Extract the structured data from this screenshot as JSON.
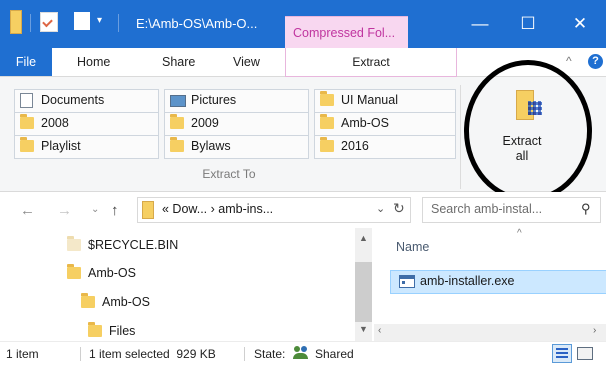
{
  "window": {
    "title": "E:\\Amb-OS\\Amb-O...",
    "context_tab": "Compressed Fol...",
    "controls": {
      "minimize": "—",
      "maximize": "☐",
      "close": "✕"
    }
  },
  "quick_access": [
    "folder-icon",
    "properties-icon",
    "new-folder-icon",
    "customize-dropdown-icon"
  ],
  "ribbon_tabs": [
    {
      "label": "File"
    },
    {
      "label": "Home"
    },
    {
      "label": "Share"
    },
    {
      "label": "View"
    },
    {
      "label": "Extract"
    }
  ],
  "extract_to": {
    "group_label": "Extract To",
    "destinations": [
      {
        "label": "Documents",
        "icon": "documents-icon"
      },
      {
        "label": "Pictures",
        "icon": "pictures-icon"
      },
      {
        "label": "UI Manual",
        "icon": "folder-icon"
      },
      {
        "label": "2008",
        "icon": "folder-icon"
      },
      {
        "label": "2009",
        "icon": "folder-icon"
      },
      {
        "label": "Amb-OS",
        "icon": "folder-icon"
      },
      {
        "label": "Playlist",
        "icon": "folder-icon"
      },
      {
        "label": "Bylaws",
        "icon": "folder-icon"
      },
      {
        "label": "2016",
        "icon": "folder-icon"
      }
    ]
  },
  "extract_all": {
    "label": "Extract\nall"
  },
  "address_bar": {
    "path": "« Dow... › amb-ins...",
    "search_placeholder": "Search amb-instal..."
  },
  "nav_tree": [
    {
      "label": "$RECYCLE.BIN"
    },
    {
      "label": "Amb-OS"
    },
    {
      "label": "Amb-OS"
    },
    {
      "label": "Files"
    }
  ],
  "file_list": {
    "column_header": "Name",
    "files": [
      {
        "name": "amb-installer.exe",
        "selected": true
      }
    ]
  },
  "status_bar": {
    "item_count": "1 item",
    "selection": "1 item selected  929 KB",
    "state_label": "State:",
    "state_value": "Shared"
  },
  "colors": {
    "accent": "#1f6fd1",
    "context_tab": "#c0359f",
    "selection": "#cce8ff"
  }
}
